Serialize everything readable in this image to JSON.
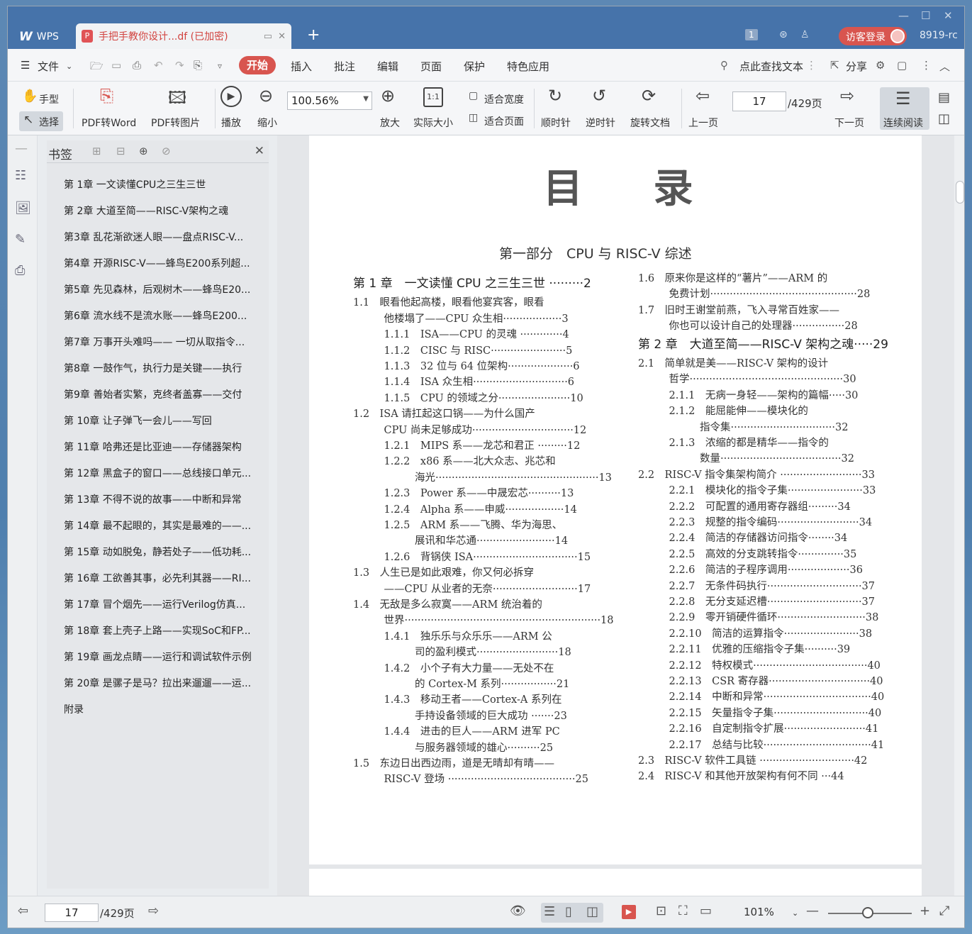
{
  "app": {
    "logo_label": "WPS",
    "tab_title": "手把手教你设计...df (已加密)",
    "add_tab_icon": "+",
    "page_indicator": "1",
    "login_button": "访客登录",
    "user_label": "8919-rc"
  },
  "menu": {
    "file_label": "文件",
    "tabs": [
      "开始",
      "插入",
      "批注",
      "编辑",
      "页面",
      "保护",
      "特色应用"
    ],
    "search_label": "点此查找文本",
    "share_label": "分享"
  },
  "toolbar": {
    "hand_label": "手型",
    "select_label": "选择",
    "pdf_word": "PDF转Word",
    "pdf_image": "PDF转图片",
    "play": "播放",
    "zoom_out": "缩小",
    "zoom_value": "100.56%",
    "zoom_in": "放大",
    "actual_size": "实际大小",
    "fit_width": "适合宽度",
    "fit_page": "适合页面",
    "clockwise": "顺时针",
    "counter_clockwise": "逆时针",
    "rotate_doc": "旋转文档",
    "prev_page": "上一页",
    "page_value": "17",
    "page_total": "/429页",
    "next_page": "下一页",
    "continuous": "连续阅读"
  },
  "bookmarks": {
    "title": "书签",
    "items": [
      "第 1章 一文读懂CPU之三生三世",
      "第 2章 大道至简——RISC-V架构之魂",
      "第3章 乱花渐欲迷人眼——盘点RISC-V...",
      "第4章 开源RISC-V——蜂鸟E200系列超...",
      "第5章 先见森林，后观树木——蜂鸟E20...",
      "第6章 流水线不是流水账——蜂鸟E200...",
      "第7章 万事开头难吗—— 一切从取指令...",
      "第8章 一鼓作气，执行力是关键——执行",
      "第9章 善始者实繁，克终者盖寡——交付",
      "第 10章 让子弹飞一会儿——写回",
      "第 11章 哈弗还是比亚迪——存储器架构",
      "第 12章 黑盒子的窗口——总线接口单元...",
      "第 13章 不得不说的故事——中断和异常",
      "第 14章 最不起眼的，其实是最难的——...",
      "第 15章 动如脱兔，静若处子——低功耗...",
      "第 16章 工欲善其事，必先利其器——RI...",
      "第 17章 冒个烟先——运行Verilog仿真...",
      "第 18章 套上壳子上路——实现SoC和FP...",
      "第 19章 画龙点睛——运行和调试软件示例",
      "第 20章 是骡子是马？拉出来遛遛——运...",
      "附录"
    ]
  },
  "doc": {
    "title": "目 录",
    "part": "第一部分　CPU 与 RISC-V 综述",
    "left_col": [
      {
        "t": "第 1 章　一文读懂 CPU 之三生三世 ·········2",
        "ch": true
      },
      {
        "t": "1.1　眼看他起高楼，眼看他宴宾客，眼看"
      },
      {
        "t": "　　　他楼塌了——CPU 众生相··················3"
      },
      {
        "t": "　　　1.1.1　ISA——CPU 的灵魂 ·············4"
      },
      {
        "t": "　　　1.1.2　CISC 与 RISC·······················5"
      },
      {
        "t": "　　　1.1.3　32 位与 64 位架构····················6"
      },
      {
        "t": "　　　1.1.4　ISA 众生相·····························6"
      },
      {
        "t": "　　　1.1.5　CPU 的领域之分······················10"
      },
      {
        "t": "1.2　ISA 请扛起这口锅——为什么国产"
      },
      {
        "t": "　　　CPU 尚未足够成功·······························12"
      },
      {
        "t": "　　　1.2.1　MIPS 系——龙芯和君正 ·········12"
      },
      {
        "t": "　　　1.2.2　x86 系——北大众志、兆芯和"
      },
      {
        "t": "　　　　　　海光··················································13"
      },
      {
        "t": "　　　1.2.3　Power 系——中晟宏芯··········13"
      },
      {
        "t": "　　　1.2.4　Alpha 系——申威··················14"
      },
      {
        "t": "　　　1.2.5　ARM 系——飞腾、华为海思、"
      },
      {
        "t": "　　　　　　展讯和华芯通························14"
      },
      {
        "t": "　　　1.2.6　背锅侠 ISA································15"
      },
      {
        "t": "1.3　人生已是如此艰难，你又何必拆穿"
      },
      {
        "t": "　　　——CPU 从业者的无奈··························17"
      },
      {
        "t": "1.4　无敌是多么寂寞——ARM 统治着的"
      },
      {
        "t": "　　　世界····························································18"
      },
      {
        "t": "　　　1.4.1　独乐乐与众乐乐——ARM 公"
      },
      {
        "t": "　　　　　　司的盈利模式·························18"
      },
      {
        "t": "　　　1.4.2　小个子有大力量——无处不在"
      },
      {
        "t": "　　　　　　的 Cortex-M 系列·················21"
      },
      {
        "t": "　　　1.4.3　移动王者——Cortex-A 系列在"
      },
      {
        "t": "　　　　　　手持设备领域的巨大成功 ·······23"
      },
      {
        "t": "　　　1.4.4　进击的巨人——ARM 进军 PC"
      },
      {
        "t": "　　　　　　与服务器领域的雄心··········25"
      },
      {
        "t": "1.5　东边日出西边雨，道是无晴却有晴——"
      },
      {
        "t": "　　　RISC-V 登场 ·······································25"
      }
    ],
    "right_col": [
      {
        "t": "1.6　原来你是这样的“薯片”——ARM 的"
      },
      {
        "t": "　　　免费计划·············································28"
      },
      {
        "t": "1.7　旧时王谢堂前燕，飞入寻常百姓家——"
      },
      {
        "t": "　　　你也可以设计自己的处理器················28"
      },
      {
        "t": "第 2 章　大道至简——RISC-V 架构之魂·····29",
        "ch": true
      },
      {
        "t": "2.1　简单就是美——RISC-V 架构的设计"
      },
      {
        "t": "　　　哲学···············································30"
      },
      {
        "t": "　　　2.1.1　无病一身轻——架构的篇幅·····30"
      },
      {
        "t": "　　　2.1.2　能屈能伸——模块化的"
      },
      {
        "t": "　　　　　　指令集································32"
      },
      {
        "t": "　　　2.1.3　浓缩的都是精华——指令的"
      },
      {
        "t": "　　　　　　数量·····································32"
      },
      {
        "t": "2.2　RISC-V 指令集架构简介 ·························33"
      },
      {
        "t": "　　　2.2.1　模块化的指令子集·······················33"
      },
      {
        "t": "　　　2.2.2　可配置的通用寄存器组·········34"
      },
      {
        "t": "　　　2.2.3　规整的指令编码·························34"
      },
      {
        "t": "　　　2.2.4　简洁的存储器访问指令········34"
      },
      {
        "t": "　　　2.2.5　高效的分支跳转指令··············35"
      },
      {
        "t": "　　　2.2.6　简洁的子程序调用···················36"
      },
      {
        "t": "　　　2.2.7　无条件码执行·····························37"
      },
      {
        "t": "　　　2.2.8　无分支延迟槽·····························37"
      },
      {
        "t": "　　　2.2.9　零开销硬件循环···························38"
      },
      {
        "t": "　　　2.2.10　简洁的运算指令·······················38"
      },
      {
        "t": "　　　2.2.11　优雅的压缩指令子集··········39"
      },
      {
        "t": "　　　2.2.12　特权模式···································40"
      },
      {
        "t": "　　　2.2.13　CSR 寄存器·······························40"
      },
      {
        "t": "　　　2.2.14　中断和异常·································40"
      },
      {
        "t": "　　　2.2.15　矢量指令子集·····························40"
      },
      {
        "t": "　　　2.2.16　自定制指令扩展·························41"
      },
      {
        "t": "　　　2.2.17　总结与比较·································41"
      },
      {
        "t": "2.3　RISC-V 软件工具链 ·····························42"
      },
      {
        "t": "2.4　RISC-V 和其他开放架构有何不同 ···44"
      }
    ]
  },
  "status": {
    "page_value": "17",
    "page_total": "/429页",
    "zoom": "101%"
  }
}
